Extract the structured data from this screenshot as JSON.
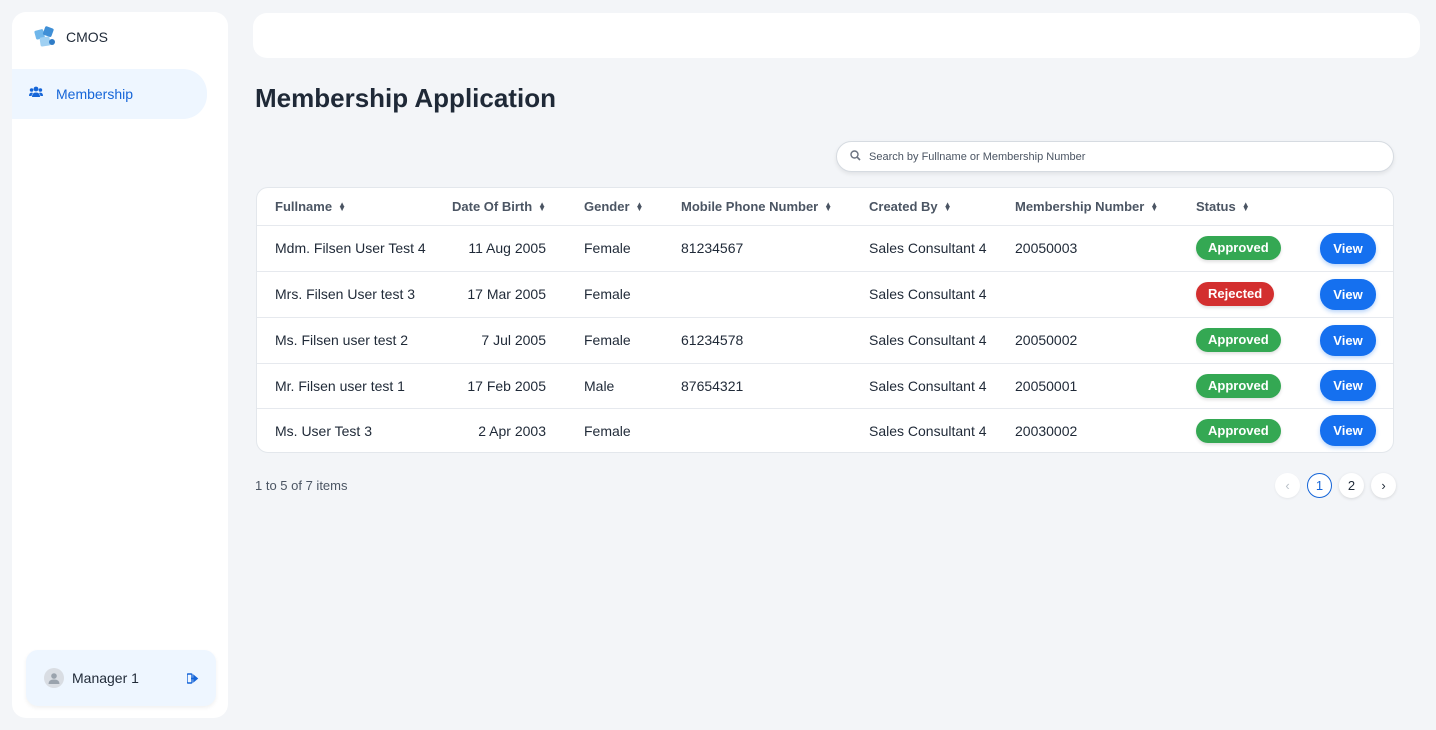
{
  "app": {
    "name": "CMOS"
  },
  "sidebar": {
    "items": [
      {
        "label": "Membership",
        "icon": "users-icon"
      }
    ]
  },
  "user": {
    "name": "Manager 1"
  },
  "page": {
    "title": "Membership Application"
  },
  "search": {
    "placeholder": "Search by Fullname or Membership Number",
    "value": ""
  },
  "table": {
    "columns": [
      "Fullname",
      "Date Of Birth",
      "Gender",
      "Mobile Phone Number",
      "Created By",
      "Membership Number",
      "Status"
    ],
    "rows": [
      {
        "fullname": "Mdm. Filsen User Test 4",
        "dob": "11 Aug 2005",
        "gender": "Female",
        "phone": "81234567",
        "created_by": "Sales Consultant 4",
        "membership_no": "20050003",
        "status": "Approved",
        "action": "View"
      },
      {
        "fullname": "Mrs. Filsen User test 3",
        "dob": "17 Mar 2005",
        "gender": "Female",
        "phone": "",
        "created_by": "Sales Consultant 4",
        "membership_no": "",
        "status": "Rejected",
        "action": "View"
      },
      {
        "fullname": "Ms. Filsen user test 2",
        "dob": "7 Jul 2005",
        "gender": "Female",
        "phone": "61234578",
        "created_by": "Sales Consultant 4",
        "membership_no": "20050002",
        "status": "Approved",
        "action": "View"
      },
      {
        "fullname": "Mr. Filsen user test 1",
        "dob": "17 Feb 2005",
        "gender": "Male",
        "phone": "87654321",
        "created_by": "Sales Consultant 4",
        "membership_no": "20050001",
        "status": "Approved",
        "action": "View"
      },
      {
        "fullname": "Ms. User Test 3",
        "dob": "2 Apr 2003",
        "gender": "Female",
        "phone": "",
        "created_by": "Sales Consultant 4",
        "membership_no": "20030002",
        "status": "Approved",
        "action": "View"
      }
    ]
  },
  "pagination": {
    "summary": "1 to 5 of 7 items",
    "prev": "‹",
    "next": "›",
    "pages": [
      "1",
      "2"
    ],
    "current": "1"
  },
  "colors": {
    "accent": "#1570ef",
    "approved": "#34a853",
    "rejected": "#d32f2f",
    "nav_active_bg": "#eef6ff"
  }
}
